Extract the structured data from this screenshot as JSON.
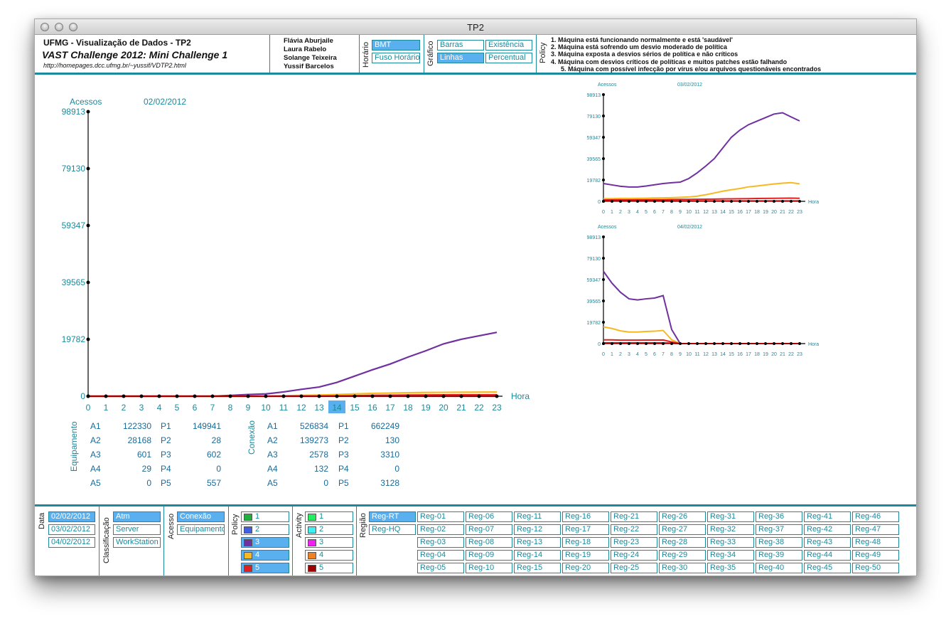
{
  "window_title": "TP2",
  "header": {
    "line1": "UFMG - Visualização de Dados - TP2",
    "line2": "VAST Challenge 2012: Mini Challenge 1",
    "url": "http://homepages.dcc.ufmg.br/~yussif/VDTP2.html",
    "authors": [
      "Flávia Aburjaile",
      "Laura Rabelo",
      "Solange Teixeira",
      "Yussif Barcelos"
    ],
    "horario_label": "Horário",
    "horario_options": [
      {
        "label": "BMT",
        "selected": true
      },
      {
        "label": "Fuso Horário",
        "selected": false
      }
    ],
    "grafico_label": "Gráfico",
    "grafico_options": [
      {
        "label": "Barras",
        "selected": false
      },
      {
        "label": "Existência",
        "selected": false
      },
      {
        "label": "Linhas",
        "selected": true
      },
      {
        "label": "Percentual",
        "selected": false
      }
    ],
    "policy_label": "Policy",
    "policy_legend": [
      "1. Máquina está funcionando normalmente e está 'saudável'",
      "2. Máquina está sofrendo um desvio moderado de política",
      "3. Máquina exposta a desvios sérios de política e não críticos",
      "4. Máquina com desvios críticos de políticas e muitos patches estão falhando",
      "5. Máquina com possível infecção por vírus e/ou arquivos questionáveis encontrados"
    ]
  },
  "colors": {
    "teal": "#1a8a9c",
    "selected": "#5ab0ee",
    "purple": "#7030a0",
    "orange": "#f8b820",
    "red": "#e02020",
    "darkred": "#a00000"
  },
  "chart_data": [
    {
      "type": "line",
      "title": "02/02/2012",
      "ylabel": "Acessos",
      "xlabel": "Hora",
      "x": [
        0,
        1,
        2,
        3,
        4,
        5,
        6,
        7,
        8,
        9,
        10,
        11,
        12,
        13,
        14,
        15,
        16,
        17,
        18,
        19,
        20,
        21,
        22,
        23
      ],
      "yticks": [
        0,
        19782,
        39565,
        59347,
        79130,
        98913
      ],
      "ylim": [
        0,
        98913
      ],
      "highlight_x": 14,
      "series": [
        {
          "color": "#7030a0",
          "values": [
            0,
            0,
            0,
            0,
            0,
            0,
            0,
            0,
            300,
            600,
            800,
            1500,
            2400,
            3200,
            4800,
            7000,
            9200,
            11200,
            13600,
            15800,
            18200,
            19800,
            21000,
            22200
          ]
        },
        {
          "color": "#f8b820",
          "values": [
            0,
            0,
            0,
            0,
            0,
            0,
            0,
            0,
            0,
            0,
            0,
            150,
            300,
            400,
            600,
            800,
            1000,
            1100,
            1200,
            1300,
            1350,
            1400,
            1420,
            1450
          ]
        },
        {
          "color": "#e02020",
          "values": [
            0,
            0,
            0,
            0,
            0,
            0,
            0,
            0,
            0,
            0,
            0,
            0,
            0,
            0,
            100,
            200,
            300,
            350,
            400,
            450,
            480,
            500,
            500,
            500
          ]
        },
        {
          "color": "#a00000",
          "values": [
            0,
            0,
            0,
            0,
            0,
            0,
            0,
            0,
            0,
            0,
            0,
            0,
            0,
            0,
            0,
            0,
            0,
            0,
            0,
            0,
            0,
            0,
            0,
            0
          ]
        }
      ]
    },
    {
      "type": "line",
      "title": "03/02/2012",
      "ylabel": "Acessos",
      "xlabel": "Hora",
      "x": [
        0,
        1,
        2,
        3,
        4,
        5,
        6,
        7,
        8,
        9,
        10,
        11,
        12,
        13,
        14,
        15,
        16,
        17,
        18,
        19,
        20,
        21,
        22,
        23
      ],
      "yticks": [
        0,
        19782,
        39565,
        59347,
        79130,
        98913
      ],
      "ylim": [
        0,
        98913
      ],
      "series": [
        {
          "color": "#7030a0",
          "values": [
            16500,
            15200,
            13900,
            13300,
            13300,
            14200,
            15300,
            16500,
            17200,
            17800,
            21100,
            26400,
            32700,
            39600,
            49500,
            59400,
            66000,
            71000,
            74300,
            77600,
            80900,
            82100,
            78200,
            74500
          ]
        },
        {
          "color": "#f8b820",
          "values": [
            2500,
            2500,
            2700,
            2700,
            2800,
            2900,
            3100,
            3200,
            3400,
            3700,
            4000,
            4800,
            6100,
            7700,
            9400,
            10700,
            11900,
            13400,
            14200,
            15200,
            16100,
            16800,
            17300,
            16200
          ]
        },
        {
          "color": "#e02020",
          "values": [
            1300,
            1400,
            1400,
            1400,
            1500,
            1500,
            1600,
            1600,
            1700,
            1800,
            1800,
            1900,
            2000,
            2100,
            2200,
            2300,
            2400,
            2500,
            2600,
            2700,
            2800,
            2900,
            3000,
            2800
          ]
        },
        {
          "color": "#a00000",
          "values": [
            300,
            300,
            300,
            300,
            300,
            300,
            300,
            300,
            300,
            300,
            300,
            300,
            300,
            300,
            300,
            300,
            300,
            300,
            300,
            300,
            300,
            300,
            300,
            300
          ]
        }
      ]
    },
    {
      "type": "line",
      "title": "04/02/2012",
      "ylabel": "Acessos",
      "xlabel": "Hora",
      "x": [
        0,
        1,
        2,
        3,
        4,
        5,
        6,
        7,
        8,
        9,
        10,
        11,
        12,
        13,
        14,
        15,
        16,
        17,
        18,
        19,
        20,
        21,
        22,
        23
      ],
      "yticks": [
        0,
        19782,
        39565,
        59347,
        79130,
        98913
      ],
      "ylim": [
        0,
        98913
      ],
      "series": [
        {
          "color": "#7030a0",
          "values": [
            67000,
            56000,
            47500,
            41500,
            40500,
            41500,
            42200,
            44500,
            13000,
            0,
            0,
            0,
            0,
            0,
            0,
            0,
            0,
            0,
            0,
            0,
            0,
            0,
            0,
            0
          ]
        },
        {
          "color": "#f8b820",
          "values": [
            15500,
            14000,
            11800,
            10700,
            10700,
            11200,
            11500,
            12200,
            3500,
            0,
            0,
            0,
            0,
            0,
            0,
            0,
            0,
            0,
            0,
            0,
            0,
            0,
            0,
            0
          ]
        },
        {
          "color": "#e02020",
          "values": [
            3500,
            3500,
            3200,
            3200,
            3200,
            3300,
            3300,
            3400,
            1500,
            0,
            0,
            0,
            0,
            0,
            0,
            0,
            0,
            0,
            0,
            0,
            0,
            0,
            0,
            0
          ]
        },
        {
          "color": "#a00000",
          "values": [
            600,
            600,
            600,
            600,
            600,
            600,
            600,
            600,
            300,
            0,
            0,
            0,
            0,
            0,
            0,
            0,
            0,
            0,
            0,
            0,
            0,
            0,
            0,
            0
          ]
        }
      ]
    }
  ],
  "stats": {
    "equip_label": "Equipamento",
    "conexao_label": "Conexão",
    "equipamento": [
      [
        "A1",
        "122330",
        "P1",
        "149941"
      ],
      [
        "A2",
        "28168",
        "P2",
        "28"
      ],
      [
        "A3",
        "601",
        "P3",
        "602"
      ],
      [
        "A4",
        "29",
        "P4",
        "0"
      ],
      [
        "A5",
        "0",
        "P5",
        "557"
      ]
    ],
    "conexao": [
      [
        "A1",
        "526834",
        "P1",
        "662249"
      ],
      [
        "A2",
        "139273",
        "P2",
        "130"
      ],
      [
        "A3",
        "2578",
        "P3",
        "3310"
      ],
      [
        "A4",
        "132",
        "P4",
        "0"
      ],
      [
        "A5",
        "0",
        "P5",
        "3128"
      ]
    ]
  },
  "filters": {
    "data_label": "Data",
    "data": [
      {
        "label": "02/02/2012",
        "selected": true
      },
      {
        "label": "03/02/2012",
        "selected": false
      },
      {
        "label": "04/02/2012",
        "selected": false
      }
    ],
    "class_label": "Classificação",
    "classificacao": [
      {
        "label": "Atm",
        "selected": true
      },
      {
        "label": "Server",
        "selected": false
      },
      {
        "label": "WorkStation",
        "selected": false
      }
    ],
    "acesso_label": "Acesso",
    "acesso": [
      {
        "label": "Conexão",
        "selected": true
      },
      {
        "label": "Equipamento",
        "selected": false
      }
    ],
    "policy_label": "Policy",
    "policy": [
      {
        "label": "1",
        "color": "#20b040",
        "selected": false
      },
      {
        "label": "2",
        "color": "#4060e0",
        "selected": false
      },
      {
        "label": "3",
        "color": "#7030a0",
        "selected": true
      },
      {
        "label": "4",
        "color": "#f8b820",
        "selected": true
      },
      {
        "label": "5",
        "color": "#e02020",
        "selected": true
      }
    ],
    "activity_label": "Activity",
    "activity": [
      {
        "label": "1",
        "color": "#20f060",
        "selected": false
      },
      {
        "label": "2",
        "color": "#40f0f0",
        "selected": false
      },
      {
        "label": "3",
        "color": "#f020f0",
        "selected": false
      },
      {
        "label": "4",
        "color": "#f08020",
        "selected": false
      },
      {
        "label": "5",
        "color": "#a00000",
        "selected": false
      }
    ],
    "regiao_label": "Região",
    "regiao_main": [
      {
        "label": "Reg-RT",
        "selected": true
      },
      {
        "label": "Reg-HQ",
        "selected": false
      }
    ],
    "regioes": [
      "Reg-01",
      "Reg-02",
      "Reg-03",
      "Reg-04",
      "Reg-05",
      "Reg-06",
      "Reg-07",
      "Reg-08",
      "Reg-09",
      "Reg-10",
      "Reg-11",
      "Reg-12",
      "Reg-13",
      "Reg-14",
      "Reg-15",
      "Reg-16",
      "Reg-17",
      "Reg-18",
      "Reg-19",
      "Reg-20",
      "Reg-21",
      "Reg-22",
      "Reg-23",
      "Reg-24",
      "Reg-25",
      "Reg-26",
      "Reg-27",
      "Reg-28",
      "Reg-29",
      "Reg-30",
      "Reg-31",
      "Reg-32",
      "Reg-33",
      "Reg-34",
      "Reg-35",
      "Reg-36",
      "Reg-37",
      "Reg-38",
      "Reg-39",
      "Reg-40",
      "Reg-41",
      "Reg-42",
      "Reg-43",
      "Reg-44",
      "Reg-45",
      "Reg-46",
      "Reg-47",
      "Reg-48",
      "Reg-49",
      "Reg-50"
    ]
  }
}
